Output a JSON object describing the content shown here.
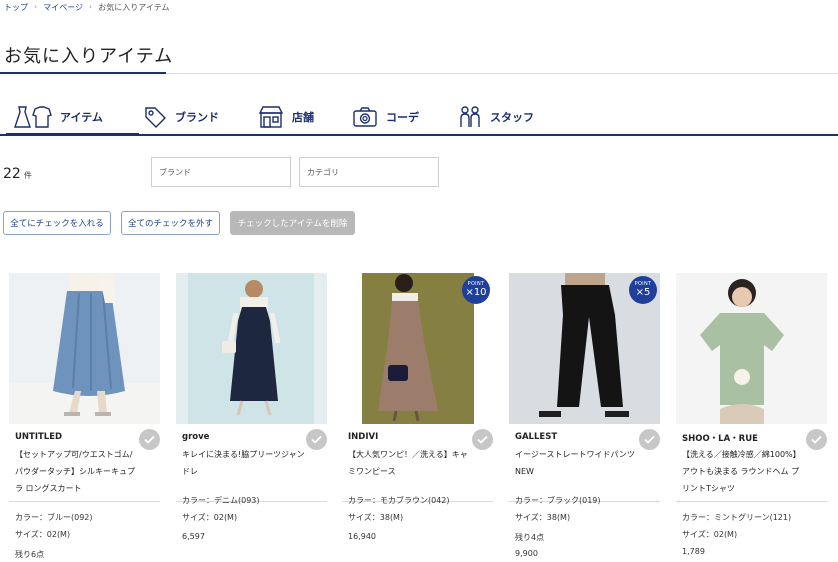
{
  "breadcrumb": [
    "トップ",
    "マイページ",
    "お気に入りアイテム"
  ],
  "page_title": "お気に入りアイテム",
  "tabs": [
    {
      "label": "アイテム",
      "icon": "clothing-icon",
      "active": true
    },
    {
      "label": "ブランド",
      "icon": "tag-icon",
      "active": false
    },
    {
      "label": "店舗",
      "icon": "store-icon",
      "active": false
    },
    {
      "label": "コーデ",
      "icon": "camera-icon",
      "active": false
    },
    {
      "label": "スタッフ",
      "icon": "staff-icon",
      "active": false
    }
  ],
  "result": {
    "count": "22",
    "unit": "件"
  },
  "filters": {
    "brand_placeholder": "ブランド",
    "category_placeholder": "カテゴリ"
  },
  "actions": {
    "check_all": "全てにチェックを入れる",
    "uncheck_all": "全てのチェックを外す",
    "delete_checked": "チェックしたアイテムを削除"
  },
  "products": [
    {
      "brand": "UNTITLED",
      "name": "【セットアップ可/ウエストゴム/パウダータッチ】シルキーキュプラ ロングスカート",
      "color": "カラー：ブルー(092)",
      "size": "サイズ：02(M)",
      "stock": "残り6点",
      "price": "",
      "point": "",
      "image_colors": {
        "bg": "#e9eef2",
        "main": "#5f88b3"
      }
    },
    {
      "brand": "grove",
      "name": "キレイに決まる!脇プリーツジャンドレ",
      "color": "カラー：デニム(093)",
      "size": "サイズ：02(M)",
      "stock": "",
      "price": "6,597",
      "point": "",
      "image_colors": {
        "bg": "#e6f0f2",
        "main": "#1f2a3c"
      }
    },
    {
      "brand": "INDIVI",
      "name": "【大人気ワンピ！／洗える】キャミワンピース",
      "color": "カラー：モカブラウン(042)",
      "size": "サイズ：38(M)",
      "stock": "",
      "price": "16,940",
      "point": "×10",
      "image_colors": {
        "bg": "#858042",
        "main": "#9a7a68"
      }
    },
    {
      "brand": "GALLEST",
      "name": "イージーストレートワイドパンツNEW",
      "color": "カラー：ブラック(019)",
      "size": "サイズ：38(M)",
      "stock": "残り4点",
      "price": "9,900",
      "point": "×5",
      "image_colors": {
        "bg": "#d8dbe0",
        "main": "#141414"
      }
    },
    {
      "brand": "SHOO・LA・RUE",
      "name": "【洗える／接触冷感／綿100%】アウトも決まる ラウンドヘム プリントTシャツ",
      "color": "カラー：ミントグリーン(121)",
      "size": "サイズ：02(M)",
      "stock": "",
      "price": "1,789",
      "point": "",
      "image_colors": {
        "bg": "#f4f4f4",
        "main": "#a8bfa2"
      }
    }
  ],
  "point_label": "POINT",
  "colors": {
    "accent": "#1c2f6e",
    "badge": "#1f3f9a",
    "disabled": "#b8b8b8"
  }
}
